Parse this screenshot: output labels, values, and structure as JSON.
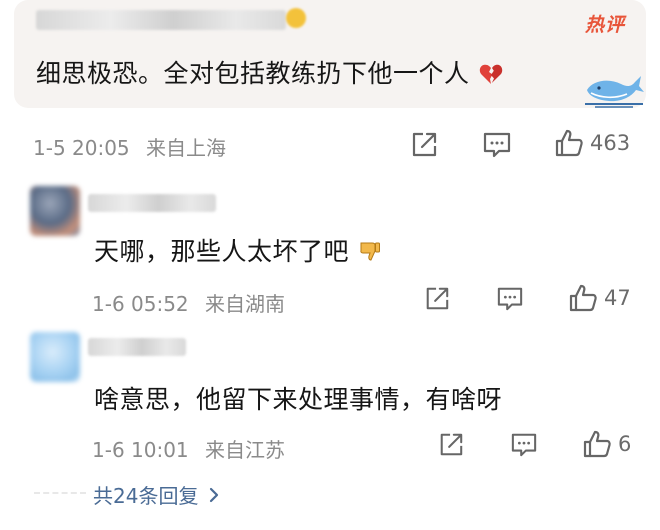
{
  "hot_comment": {
    "badge": "热评",
    "text": "细思极恐。全对包括教练扔下他一个人",
    "emoji_icon": "broken-heart-icon",
    "time": "1-5 20:05",
    "location": "来自上海",
    "likes": "463"
  },
  "replies": [
    {
      "text": "天哪，那些人太坏了吧",
      "emoji_icon": "thumbs-down-icon",
      "time": "1-6 05:52",
      "location": "来自湖南",
      "likes": "47"
    },
    {
      "text": "啥意思，他留下来处理事情，有啥呀",
      "time": "1-6 10:01",
      "location": "来自江苏",
      "likes": "6"
    }
  ],
  "more_replies": {
    "label": "共24条回复",
    "chevron_icon": "chevron-right-icon"
  },
  "colors": {
    "card_bg": "#f6f3f1",
    "hot_badge": "#e8553a",
    "link": "#4a6b95",
    "meta_text": "#8a8a8a"
  }
}
